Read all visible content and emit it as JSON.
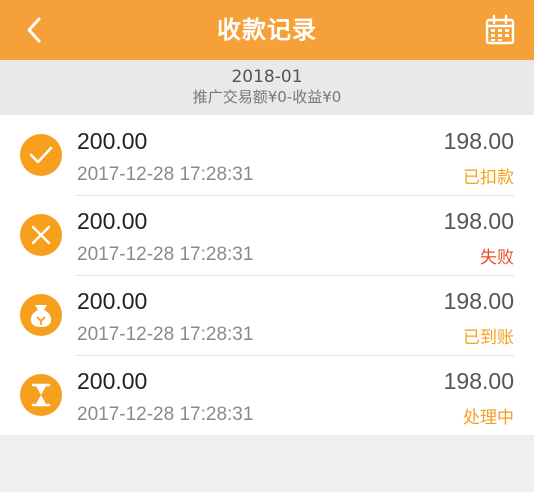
{
  "header": {
    "title": "收款记录",
    "back_icon": "chevron-left-icon",
    "calendar_icon": "calendar-icon",
    "color": "#f6a03a"
  },
  "summary": {
    "month": "2018-01",
    "totals": "推广交易额¥0-收益¥0"
  },
  "records": [
    {
      "icon": "check-icon",
      "amount": "200.00",
      "time": "2017-12-28 17:28:31",
      "net": "198.00",
      "status": "已扣款",
      "status_color": "#f6a01e"
    },
    {
      "icon": "cross-icon",
      "amount": "200.00",
      "time": "2017-12-28 17:28:31",
      "net": "198.00",
      "status": "失败",
      "status_color": "#e8502a"
    },
    {
      "icon": "money-bag-icon",
      "amount": "200.00",
      "time": "2017-12-28 17:28:31",
      "net": "198.00",
      "status": "已到账",
      "status_color": "#f6a01e"
    },
    {
      "icon": "hourglass-icon",
      "amount": "200.00",
      "time": "2017-12-28 17:28:31",
      "net": "198.00",
      "status": "处理中",
      "status_color": "#f6a01e"
    }
  ]
}
